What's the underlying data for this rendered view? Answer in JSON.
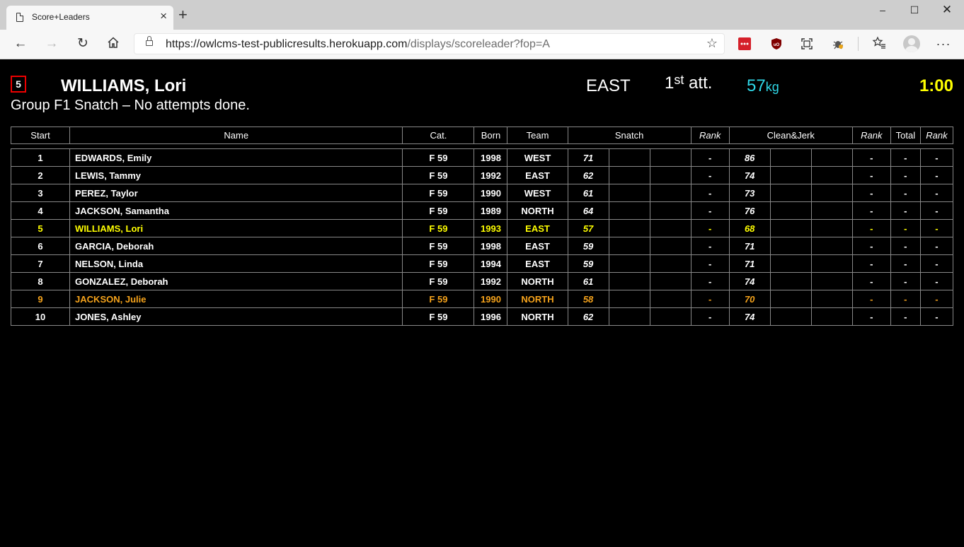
{
  "browser": {
    "tab_title": "Score+Leaders",
    "url_host": "https://owlcms-test-publicresults.herokuapp.com",
    "url_path": "/displays/scoreleader?fop=A"
  },
  "current": {
    "start_number": "5",
    "athlete": "WILLIAMS, Lori",
    "team": "EAST",
    "attempt_num": "1",
    "attempt_sup": "st",
    "attempt_suffix": "att.",
    "weight": "57",
    "weight_unit": "kg",
    "timer": "1:00",
    "group_info": "Group F1 Snatch – No attempts done."
  },
  "table": {
    "headers": {
      "start": "Start",
      "name": "Name",
      "cat": "Cat.",
      "born": "Born",
      "team": "Team",
      "snatch": "Snatch",
      "rank": "Rank",
      "cj": "Clean&Jerk",
      "total": "Total"
    },
    "rows": [
      {
        "start": "1",
        "name": "EDWARDS, Emily",
        "cat": "F 59",
        "born": "1998",
        "team": "WEST",
        "sn1": "71",
        "snr": "-",
        "cj1": "86",
        "cjr": "-",
        "total": "-",
        "rank": "-",
        "status": ""
      },
      {
        "start": "2",
        "name": "LEWIS, Tammy",
        "cat": "F 59",
        "born": "1992",
        "team": "EAST",
        "sn1": "62",
        "snr": "-",
        "cj1": "74",
        "cjr": "-",
        "total": "-",
        "rank": "-",
        "status": ""
      },
      {
        "start": "3",
        "name": "PEREZ, Taylor",
        "cat": "F 59",
        "born": "1990",
        "team": "WEST",
        "sn1": "61",
        "snr": "-",
        "cj1": "73",
        "cjr": "-",
        "total": "-",
        "rank": "-",
        "status": ""
      },
      {
        "start": "4",
        "name": "JACKSON, Samantha",
        "cat": "F 59",
        "born": "1989",
        "team": "NORTH",
        "sn1": "64",
        "snr": "-",
        "cj1": "76",
        "cjr": "-",
        "total": "-",
        "rank": "-",
        "status": ""
      },
      {
        "start": "5",
        "name": "WILLIAMS, Lori",
        "cat": "F 59",
        "born": "1993",
        "team": "EAST",
        "sn1": "57",
        "snr": "-",
        "cj1": "68",
        "cjr": "-",
        "total": "-",
        "rank": "-",
        "status": "current"
      },
      {
        "start": "6",
        "name": "GARCIA, Deborah",
        "cat": "F 59",
        "born": "1998",
        "team": "EAST",
        "sn1": "59",
        "snr": "-",
        "cj1": "71",
        "cjr": "-",
        "total": "-",
        "rank": "-",
        "status": ""
      },
      {
        "start": "7",
        "name": "NELSON, Linda",
        "cat": "F 59",
        "born": "1994",
        "team": "EAST",
        "sn1": "59",
        "snr": "-",
        "cj1": "71",
        "cjr": "-",
        "total": "-",
        "rank": "-",
        "status": ""
      },
      {
        "start": "8",
        "name": "GONZALEZ, Deborah",
        "cat": "F 59",
        "born": "1992",
        "team": "NORTH",
        "sn1": "61",
        "snr": "-",
        "cj1": "74",
        "cjr": "-",
        "total": "-",
        "rank": "-",
        "status": ""
      },
      {
        "start": "9",
        "name": "JACKSON, Julie",
        "cat": "F 59",
        "born": "1990",
        "team": "NORTH",
        "sn1": "58",
        "snr": "-",
        "cj1": "70",
        "cjr": "-",
        "total": "-",
        "rank": "-",
        "status": "next"
      },
      {
        "start": "10",
        "name": "JONES, Ashley",
        "cat": "F 59",
        "born": "1996",
        "team": "NORTH",
        "sn1": "62",
        "snr": "-",
        "cj1": "74",
        "cjr": "-",
        "total": "-",
        "rank": "-",
        "status": ""
      }
    ]
  },
  "colors": {
    "background": "#000000",
    "current_athlete": "#ffff00",
    "next_athlete": "#f6a31b",
    "weight": "#2fd8e8",
    "timer": "#ffff00",
    "start_box_border": "#ee0000"
  }
}
